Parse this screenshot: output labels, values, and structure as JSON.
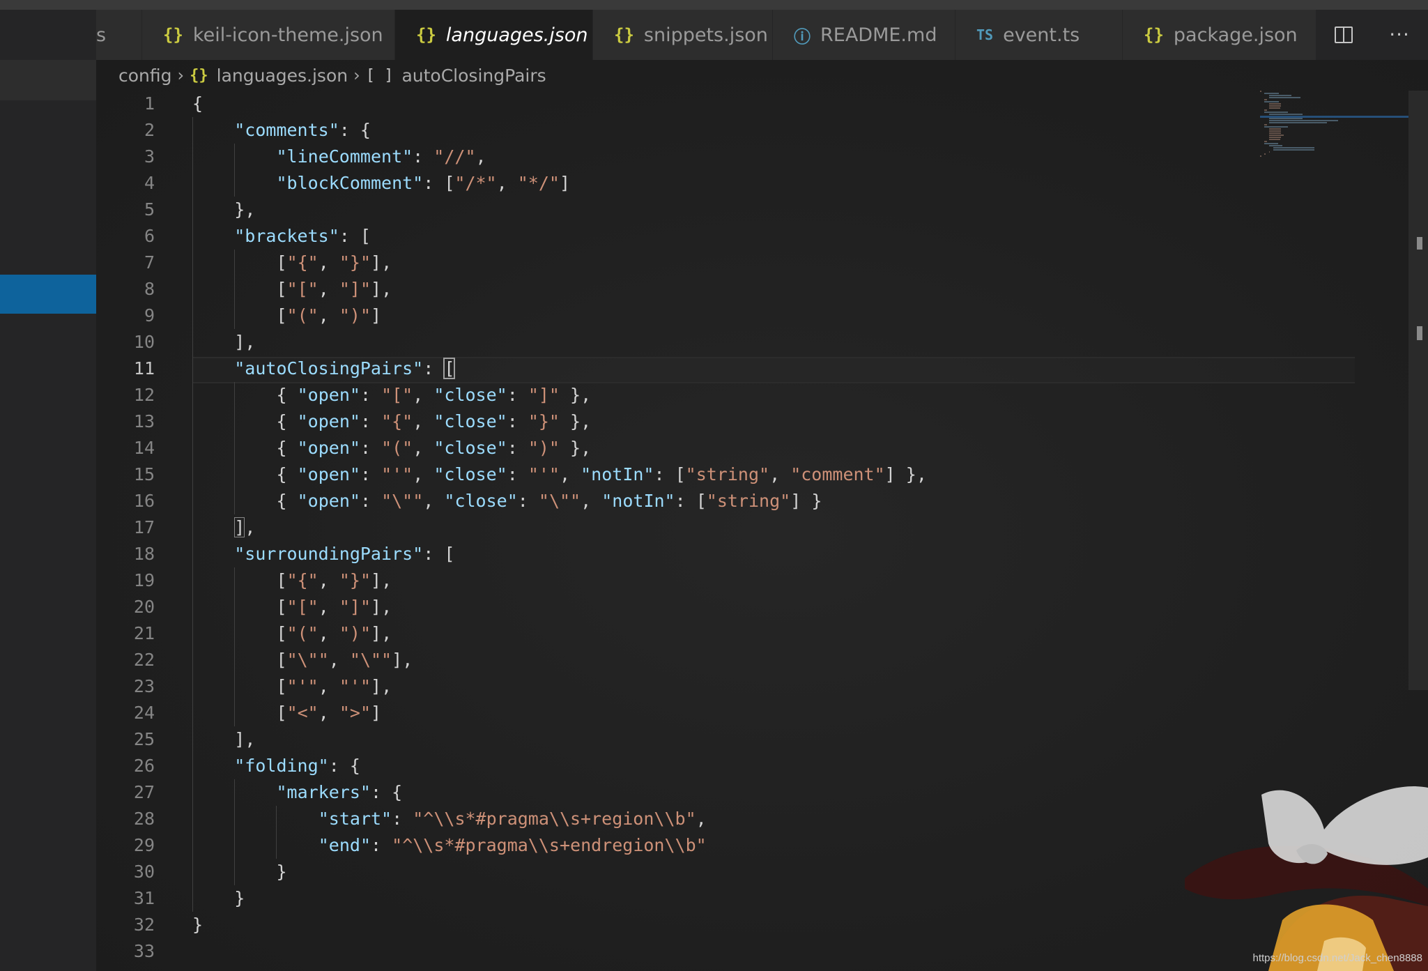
{
  "tabs": [
    {
      "label": "s",
      "icon": "none"
    },
    {
      "label": "keil-icon-theme.json",
      "icon": "json-braces-icon"
    },
    {
      "label": "languages.json",
      "icon": "json-braces-icon",
      "active": true
    },
    {
      "label": "snippets.json",
      "icon": "json-braces-icon"
    },
    {
      "label": "README.md",
      "icon": "info-icon"
    },
    {
      "label": "event.ts",
      "icon": "typescript-icon"
    },
    {
      "label": "package.json",
      "icon": "json-braces-icon"
    }
  ],
  "icon_glyphs": {
    "json": "{}",
    "info": "ⓘ",
    "ts": "TS",
    "close": "×",
    "chevron": "›",
    "array": "[ ]"
  },
  "breadcrumb": {
    "folder": "config",
    "file": "languages.json",
    "symbol": "autoClosingPairs"
  },
  "editor": {
    "current_line": 11,
    "lines": [
      {
        "n": "1",
        "code": "{"
      },
      {
        "n": "2",
        "code": "    \"comments\": {"
      },
      {
        "n": "3",
        "code": "        \"lineComment\": \"//\","
      },
      {
        "n": "4",
        "code": "        \"blockComment\": [\"/*\", \"*/\"]"
      },
      {
        "n": "5",
        "code": "    },"
      },
      {
        "n": "6",
        "code": "    \"brackets\": ["
      },
      {
        "n": "7",
        "code": "        [\"{\", \"}\"],"
      },
      {
        "n": "8",
        "code": "        [\"[\", \"]\"],"
      },
      {
        "n": "9",
        "code": "        [\"(\", \")\"]"
      },
      {
        "n": "10",
        "code": "    ],"
      },
      {
        "n": "11",
        "code": "    \"autoClosingPairs\": ["
      },
      {
        "n": "12",
        "code": "        { \"open\": \"[\", \"close\": \"]\" },"
      },
      {
        "n": "13",
        "code": "        { \"open\": \"{\", \"close\": \"}\" },"
      },
      {
        "n": "14",
        "code": "        { \"open\": \"(\", \"close\": \")\" },"
      },
      {
        "n": "15",
        "code": "        { \"open\": \"'\", \"close\": \"'\", \"notIn\": [\"string\", \"comment\"] },"
      },
      {
        "n": "16",
        "code": "        { \"open\": \"\\\"\", \"close\": \"\\\"\", \"notIn\": [\"string\"] }"
      },
      {
        "n": "17",
        "code": "    ],"
      },
      {
        "n": "18",
        "code": "    \"surroundingPairs\": ["
      },
      {
        "n": "19",
        "code": "        [\"{\", \"}\"],"
      },
      {
        "n": "20",
        "code": "        [\"[\", \"]\"],"
      },
      {
        "n": "21",
        "code": "        [\"(\", \")\"],"
      },
      {
        "n": "22",
        "code": "        [\"\\\"\", \"\\\"\"],"
      },
      {
        "n": "23",
        "code": "        [\"'\", \"'\"],"
      },
      {
        "n": "24",
        "code": "        [\"<\", \">\"]"
      },
      {
        "n": "25",
        "code": "    ],"
      },
      {
        "n": "26",
        "code": "    \"folding\": {"
      },
      {
        "n": "27",
        "code": "        \"markers\": {"
      },
      {
        "n": "28",
        "code": "            \"start\": \"^\\\\s*#pragma\\\\s+region\\\\b\","
      },
      {
        "n": "29",
        "code": "            \"end\": \"^\\\\s*#pragma\\\\s+endregion\\\\b\""
      },
      {
        "n": "30",
        "code": "        }"
      },
      {
        "n": "31",
        "code": "    }"
      },
      {
        "n": "32",
        "code": "}"
      },
      {
        "n": "33",
        "code": ""
      }
    ]
  },
  "watermark": "https://blog.csdn.net/Jack_chen8888",
  "colors": {
    "key": "#9cdcfe",
    "string": "#ce9178",
    "punct": "#d4d4d4",
    "line_number": "#858585",
    "json_icon": "#cbcb41",
    "info_icon": "#519aba",
    "selection": "#0e639c"
  }
}
